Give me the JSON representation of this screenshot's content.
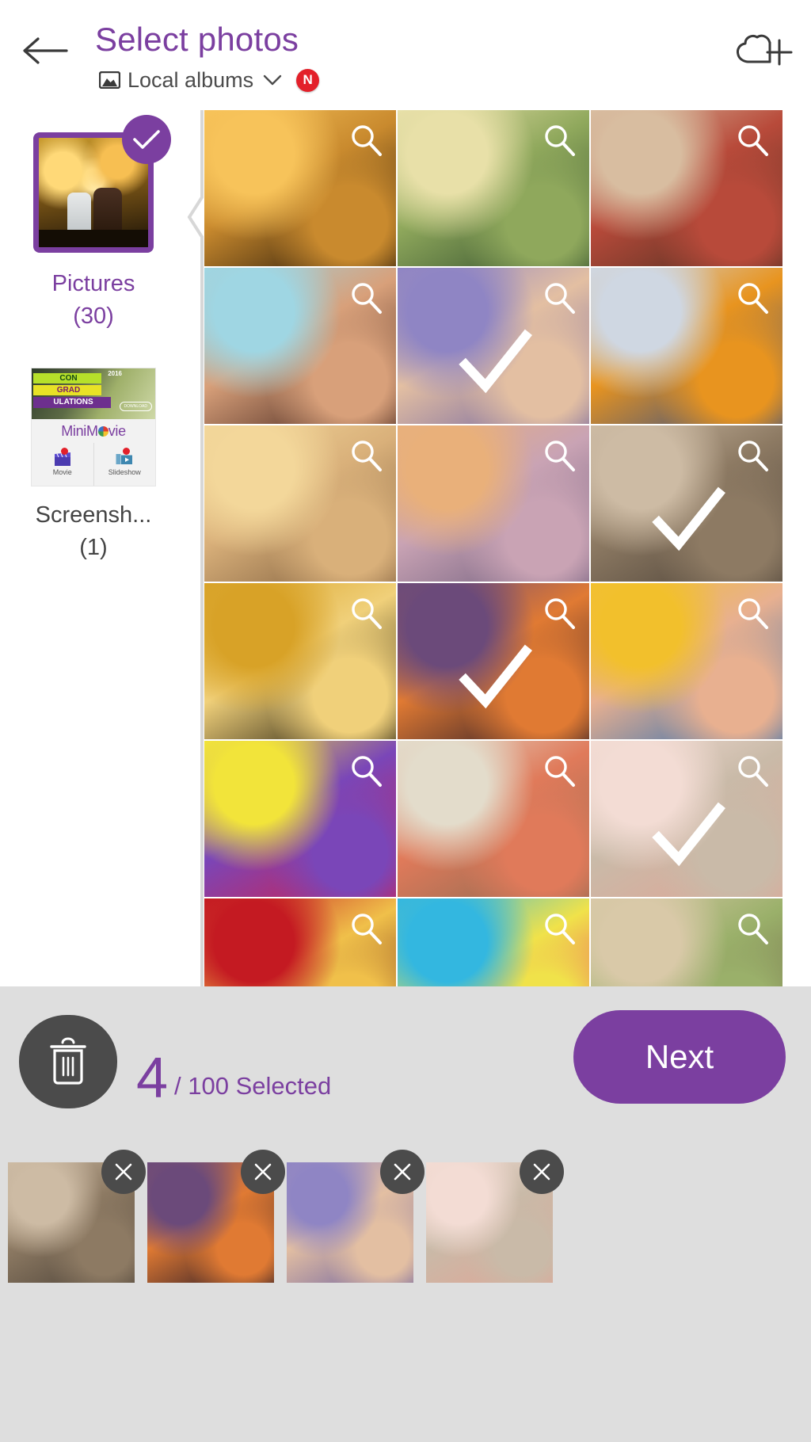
{
  "header": {
    "title": "Select photos",
    "back_icon": "back-arrow-icon",
    "source_label": "Local albums",
    "source_icon": "image-album-icon",
    "dropdown_icon": "chevron-down-icon",
    "badge_text": "N",
    "badge_color": "#e3202a",
    "cloud_icon": "cloud-add-icon",
    "accent_color": "#7b3fa0"
  },
  "sidebar": {
    "albums": [
      {
        "name": "Pictures",
        "count": "(30)",
        "selected": true,
        "check_icon": "check-icon"
      },
      {
        "name": "Screensh...",
        "count": "(1)",
        "selected": false,
        "check_icon": "check-icon"
      }
    ],
    "ad": {
      "brand_pre": "MiniM",
      "brand_post": "vie",
      "banner_line1": "CON",
      "banner_line2": "GRAD",
      "banner_line3": "ULATIONS",
      "banner_year": "2016",
      "download_label": "DOWNLOAD",
      "actions": [
        {
          "label": "Movie",
          "icon": "clapperboard-icon"
        },
        {
          "label": "Slideshow",
          "icon": "slideshow-icon"
        }
      ]
    }
  },
  "grid": {
    "magnifier_icon": "magnifier-icon",
    "check_icon": "check-icon",
    "photos": [
      {
        "id": "p1",
        "alt": "Children hugging at sunset",
        "selected": false,
        "magnifier": true,
        "c1": "#f7c35a",
        "c2": "#1b0f05",
        "c3": "#c98a2e"
      },
      {
        "id": "p2",
        "alt": "Couple piggyback in autumn park",
        "selected": false,
        "magnifier": true,
        "c1": "#e8e0a8",
        "c2": "#2d4a2a",
        "c3": "#8fa85c"
      },
      {
        "id": "p3",
        "alt": "Couple embracing in street",
        "selected": false,
        "magnifier": true,
        "c1": "#d8bda0",
        "c2": "#4a2e20",
        "c3": "#b84a3a"
      },
      {
        "id": "p4",
        "alt": "Couple lying down laughing",
        "selected": false,
        "magnifier": true,
        "c1": "#9fd6e3",
        "c2": "#3a1c16",
        "c3": "#d8a07a"
      },
      {
        "id": "p5",
        "alt": "Holding hands over lavender field",
        "selected": true,
        "magnifier": true,
        "c1": "#8f85c4",
        "c2": "#6b5fa0",
        "c3": "#e3bfa2"
      },
      {
        "id": "p6",
        "alt": "Couple cheering with shopping bags",
        "selected": false,
        "magnifier": true,
        "c1": "#cfd7e2",
        "c2": "#2a4a8c",
        "c3": "#e8941f"
      },
      {
        "id": "p7",
        "alt": "Couple kissing on the beach",
        "selected": false,
        "magnifier": true,
        "c1": "#f3d79a",
        "c2": "#7a5a3a",
        "c3": "#d9b07a"
      },
      {
        "id": "p8",
        "alt": "Shoreline at dusk",
        "selected": false,
        "magnifier": true,
        "c1": "#e9b07a",
        "c2": "#6a5a7a",
        "c3": "#c9a3b4"
      },
      {
        "id": "p9",
        "alt": "Couple walking holding hands",
        "selected": true,
        "magnifier": true,
        "c1": "#cdbba4",
        "c2": "#4a4036",
        "c3": "#8d7a63"
      },
      {
        "id": "p10",
        "alt": "Champagne glasses toasting",
        "selected": false,
        "magnifier": true,
        "c1": "#d8a227",
        "c2": "#110d05",
        "c3": "#f0d07a"
      },
      {
        "id": "p11",
        "alt": "Light painting hearts at sunset",
        "selected": true,
        "magnifier": true,
        "c1": "#6b4a7a",
        "c2": "#1c1326",
        "c3": "#e07a33"
      },
      {
        "id": "p12",
        "alt": "Couple under yellow umbrella",
        "selected": false,
        "magnifier": true,
        "c1": "#f2c02c",
        "c2": "#2a6bb0",
        "c3": "#e8b090"
      },
      {
        "id": "p13",
        "alt": "Colorful decorated cupcakes",
        "selected": false,
        "magnifier": true,
        "c1": "#f2e43a",
        "c2": "#d31f4a",
        "c3": "#7a46b8"
      },
      {
        "id": "p14",
        "alt": "Couple with map in the city",
        "selected": false,
        "magnifier": true,
        "c1": "#e3dccb",
        "c2": "#8a6a52",
        "c3": "#e07a5a"
      },
      {
        "id": "p15",
        "alt": "Pink rose cupcakes",
        "selected": true,
        "magnifier": true,
        "c1": "#f3dcd4",
        "c2": "#e0a596",
        "c3": "#c9baa8"
      },
      {
        "id": "p16",
        "alt": "Red roses with candle",
        "selected": false,
        "magnifier": true,
        "c1": "#c41a22",
        "c2": "#5a0c10",
        "c3": "#f0c04a"
      },
      {
        "id": "p17",
        "alt": "Couple in front of graffiti wall",
        "selected": false,
        "magnifier": true,
        "c1": "#33b7e0",
        "c2": "#e8206a",
        "c3": "#f0e24a"
      },
      {
        "id": "p18",
        "alt": "Gondolier on Venice canal",
        "selected": false,
        "magnifier": true,
        "c1": "#d9c9a8",
        "c2": "#6a5a42",
        "c3": "#9ab06a"
      }
    ]
  },
  "bottom": {
    "trash_icon": "trash-icon",
    "selected_count": "4",
    "count_suffix": "/ 100 Selected",
    "next_label": "Next",
    "remove_icon": "close-icon",
    "selected_thumbs": [
      {
        "id": "s1",
        "alt": "Couple walking holding hands",
        "c1": "#cdbba4",
        "c2": "#4a4036",
        "c3": "#8d7a63"
      },
      {
        "id": "s2",
        "alt": "Light painting hearts at sunset",
        "c1": "#6b4a7a",
        "c2": "#1c1326",
        "c3": "#e07a33"
      },
      {
        "id": "s3",
        "alt": "Holding hands over lavender field",
        "c1": "#8f85c4",
        "c2": "#6b5fa0",
        "c3": "#e3bfa2"
      },
      {
        "id": "s4",
        "alt": "Pink rose cupcakes",
        "c1": "#f3dcd4",
        "c2": "#e0a596",
        "c3": "#c9baa8"
      }
    ]
  }
}
